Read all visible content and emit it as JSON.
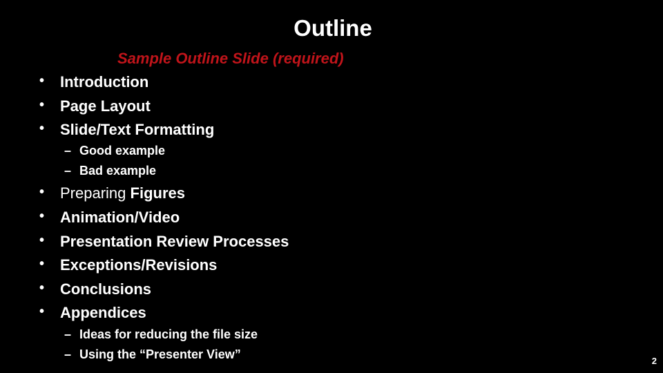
{
  "slide": {
    "title": "Outline",
    "subtitle": "Sample Outline Slide (required)",
    "subtitle_color": "#c0141a",
    "bullet_glyph": "•",
    "dash_glyph": "–",
    "items": [
      {
        "label": "Introduction"
      },
      {
        "label": "Page Layout"
      },
      {
        "label": "Slide/Text Formatting",
        "subitems": [
          {
            "label": "Good example"
          },
          {
            "label": "Bad example"
          }
        ]
      },
      {
        "label_prefix": "Preparing ",
        "label": "Figures"
      },
      {
        "label": "Animation/Video"
      },
      {
        "label": "Presentation Review Processes"
      },
      {
        "label": "Exceptions/Revisions"
      },
      {
        "label": "Conclusions"
      },
      {
        "label": "Appendices",
        "subitems": [
          {
            "label": "Ideas for reducing the file size"
          },
          {
            "label": "Using the “Presenter View”"
          }
        ]
      }
    ],
    "page_number": "2"
  }
}
